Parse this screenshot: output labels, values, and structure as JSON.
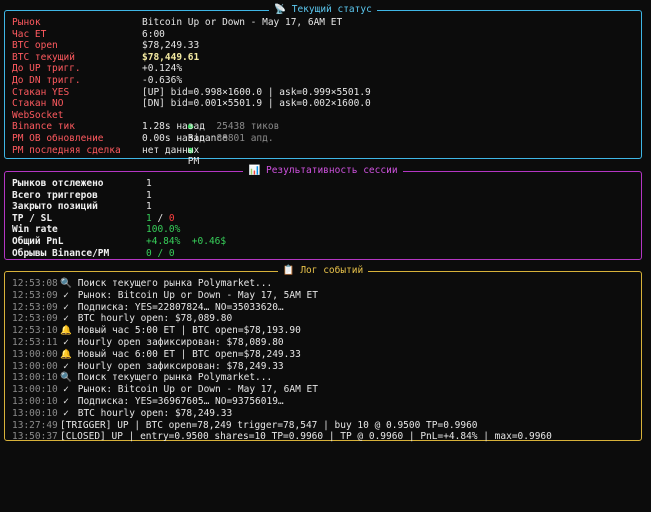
{
  "status": {
    "title": "📡 Текущий статус",
    "rows": [
      {
        "key": "Рынок",
        "value": "Bitcoin Up or Down - May 17, 6AM ET"
      },
      {
        "key": "Час ET",
        "value": "6:00"
      },
      {
        "key": "BTC open",
        "value": "$78,249.33"
      },
      {
        "key": "BTC текущий",
        "value": "$78,449.61"
      },
      {
        "key": "До UP тригг.",
        "value": "+0.124%"
      },
      {
        "key": "До DN тригг.",
        "value": "-0.636%"
      },
      {
        "key": "Стакан YES",
        "value": "[UP] bid=0.998×1600.0 | ask=0.999×5501.9"
      },
      {
        "key": "Стакан NO",
        "value": "[DN] bid=0.001×5501.9 | ask=0.002×1600.0"
      },
      {
        "key": "WebSocket",
        "ws1": "Binance",
        "ws2": "PM"
      },
      {
        "key": "Binance тик",
        "value": "1.28s назад",
        "extra": "25438 тиков"
      },
      {
        "key": "PM OB обновление",
        "value": "0.00s назад",
        "extra": "88801 апд."
      },
      {
        "key": "PM последняя сделка",
        "value": "нет данных"
      }
    ]
  },
  "performance": {
    "title": "📊 Результативность сессии",
    "rows": [
      {
        "key": "Рынков отслежено",
        "value": "1"
      },
      {
        "key": "Всего триггеров",
        "value": "1"
      },
      {
        "key": "Закрыто позиций",
        "value": "1"
      },
      {
        "key": "TP / SL",
        "tp": "1",
        "sep": " / ",
        "sl": "0"
      },
      {
        "key": "Win rate",
        "value": "100.0%"
      },
      {
        "key": "Общий PnL",
        "pct": "+4.84%",
        "usd": "+0.46$"
      },
      {
        "key": "Обрывы Binance/PM",
        "value": "0 / 0"
      }
    ]
  },
  "log": {
    "title": "📋 Лог событий",
    "entries": [
      {
        "time": "12:53:08",
        "icon": "🔍",
        "text": "Поиск текущего рынка Polymarket..."
      },
      {
        "time": "12:53:09",
        "icon": "✓",
        "text": "Рынок: Bitcoin Up or Down - May 17, 5AM ET"
      },
      {
        "time": "12:53:09",
        "icon": "✓",
        "text": "Подписка: YES=22807824… NO=35033620…"
      },
      {
        "time": "12:53:09",
        "icon": "✓",
        "text": "BTC hourly open: $78,089.80"
      },
      {
        "time": "12:53:10",
        "icon": "🔔",
        "text": "Новый час 5:00 ET | BTC open=$78,193.90"
      },
      {
        "time": "12:53:11",
        "icon": "✓",
        "text": "Hourly open зафиксирован: $78,089.80"
      },
      {
        "time": "13:00:00",
        "icon": "🔔",
        "text": "Новый час 6:00 ET | BTC open=$78,249.33"
      },
      {
        "time": "13:00:00",
        "icon": "✓",
        "text": "Hourly open зафиксирован: $78,249.33"
      },
      {
        "time": "13:00:10",
        "icon": "🔍",
        "text": "Поиск текущего рынка Polymarket..."
      },
      {
        "time": "13:00:10",
        "icon": "✓",
        "text": "Рынок: Bitcoin Up or Down - May 17, 6AM ET"
      },
      {
        "time": "13:00:10",
        "icon": "✓",
        "text": "Подписка: YES=36967605… NO=93756019…"
      },
      {
        "time": "13:00:10",
        "icon": "✓",
        "text": "BTC hourly open: $78,249.33"
      },
      {
        "time": "13:27:49",
        "icon": "",
        "text": "[TRIGGER] UP | BTC open=78,249 trigger=78,547 | buy 10 @ 0.9500 TP=0.9960"
      },
      {
        "time": "13:50:37",
        "icon": "",
        "text": "[CLOSED] UP | entry=0.9500 shares=10 TP=0.9960 | TP @ 0.9960 | PnL=+4.84% | max=0.9960"
      }
    ]
  },
  "colors": {
    "status_border": "#3fb7e6",
    "perf_border": "#b436c4",
    "log_border": "#d8b23a",
    "label_red": "#ff5a5f",
    "positive": "#37d05a",
    "negative": "#ff4040"
  }
}
